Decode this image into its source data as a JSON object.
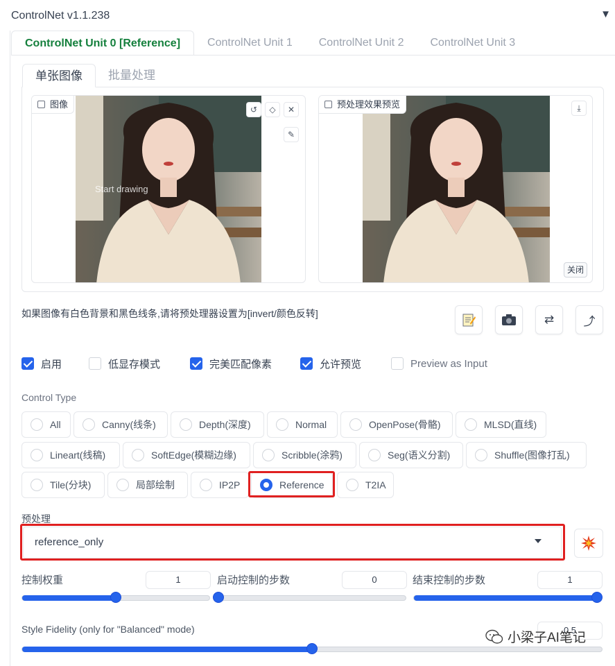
{
  "header": {
    "title": "ControlNet v1.1.238",
    "collapse_icon": "triangle-down-icon"
  },
  "unit_tabs": [
    {
      "label": "ControlNet Unit 0 [Reference]",
      "active": true
    },
    {
      "label": "ControlNet Unit 1",
      "active": false
    },
    {
      "label": "ControlNet Unit 2",
      "active": false
    },
    {
      "label": "ControlNet Unit 3",
      "active": false
    }
  ],
  "image_tabs": [
    {
      "label": "单张图像",
      "active": true
    },
    {
      "label": "批量处理",
      "active": false
    }
  ],
  "input_image": {
    "label": "图像",
    "watermark": "Start drawing"
  },
  "preview_image": {
    "label": "预处理效果预览",
    "close_label": "关闭"
  },
  "hint": "如果图像有白色背景和黑色线条,请将预处理器设置为[invert/颜色反转]",
  "checkboxes": [
    {
      "label": "启用",
      "checked": true
    },
    {
      "label": "低显存模式",
      "checked": false
    },
    {
      "label": "完美匹配像素",
      "checked": true
    },
    {
      "label": "允许预览",
      "checked": true
    },
    {
      "label": "Preview as Input",
      "checked": false
    }
  ],
  "control_type": {
    "label": "Control Type",
    "selected": "Reference",
    "options": [
      "All",
      "Canny(线条)",
      "Depth(深度)",
      "Normal",
      "OpenPose(骨骼)",
      "MLSD(直线)",
      "Lineart(线稿)",
      "SoftEdge(模糊边缘)",
      "Scribble(涂鸦)",
      "Seg(语义分割)",
      "Shuffle(图像打乱)",
      "Tile(分块)",
      "局部绘制",
      "IP2P",
      "Reference",
      "T2IA"
    ]
  },
  "preprocessor": {
    "label": "预处理",
    "value": "reference_only",
    "run_icon": "explosion-icon"
  },
  "sliders": [
    {
      "label": "控制权重",
      "value": "1",
      "fraction": 0.5
    },
    {
      "label": "启动控制的步数",
      "value": "0",
      "fraction": 0.0
    },
    {
      "label": "结束控制的步数",
      "value": "1",
      "fraction": 1.0
    }
  ],
  "style_fidelity": {
    "label": "Style Fidelity (only for \"Balanced\" mode)",
    "value": "0.5",
    "fraction": 0.5
  },
  "brand_watermark": "小梁子AI笔记",
  "colors": {
    "accent": "#2563eb",
    "active_tab": "#15803d",
    "highlight": "#e02020"
  }
}
